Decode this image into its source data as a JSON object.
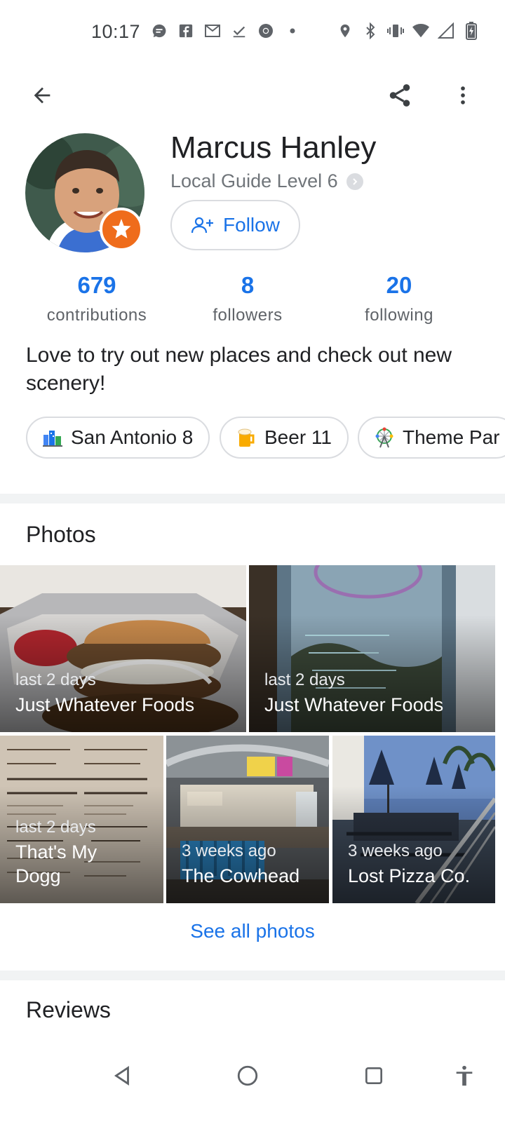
{
  "status_bar": {
    "time": "10:17",
    "left_icons": [
      "chat-bubble-icon",
      "facebook-icon",
      "gmail-icon",
      "check-icon",
      "chrome-icon",
      "dot-icon"
    ],
    "right_icons": [
      "location-icon",
      "bluetooth-icon",
      "vibrate-icon",
      "wifi-icon",
      "signal-icon",
      "battery-charging-icon"
    ]
  },
  "top_bar": {
    "back_icon": "arrow-back-icon",
    "share_icon": "share-icon",
    "more_icon": "more-vert-icon"
  },
  "profile": {
    "name": "Marcus Hanley",
    "guide_level": "Local Guide Level 6",
    "follow_label": "Follow",
    "bio": "Love to try out new places and check out new scenery!"
  },
  "stats": [
    {
      "value": "679",
      "label": "contributions"
    },
    {
      "value": "8",
      "label": "followers"
    },
    {
      "value": "20",
      "label": "following"
    }
  ],
  "chips": [
    {
      "label": "San Antonio 8",
      "icon": "city-icon"
    },
    {
      "label": "Beer 11",
      "icon": "beer-icon"
    },
    {
      "label": "Theme Par",
      "icon": "ferris-wheel-icon"
    }
  ],
  "photos": {
    "title": "Photos",
    "items": [
      {
        "time": "last 2 days",
        "place": "Just Whatever Foods"
      },
      {
        "time": "last 2 days",
        "place": "Just Whatever Foods"
      },
      {
        "time": "last 2 days",
        "place": "That's My Dogg"
      },
      {
        "time": "3 weeks ago",
        "place": "The Cowhead"
      },
      {
        "time": "3 weeks ago",
        "place": "Lost Pizza Co."
      }
    ],
    "see_all": "See all photos"
  },
  "reviews": {
    "title": "Reviews"
  },
  "colors": {
    "accent": "#1a73e8",
    "badge": "#ef6c1b",
    "divider": "#f1f3f4"
  }
}
